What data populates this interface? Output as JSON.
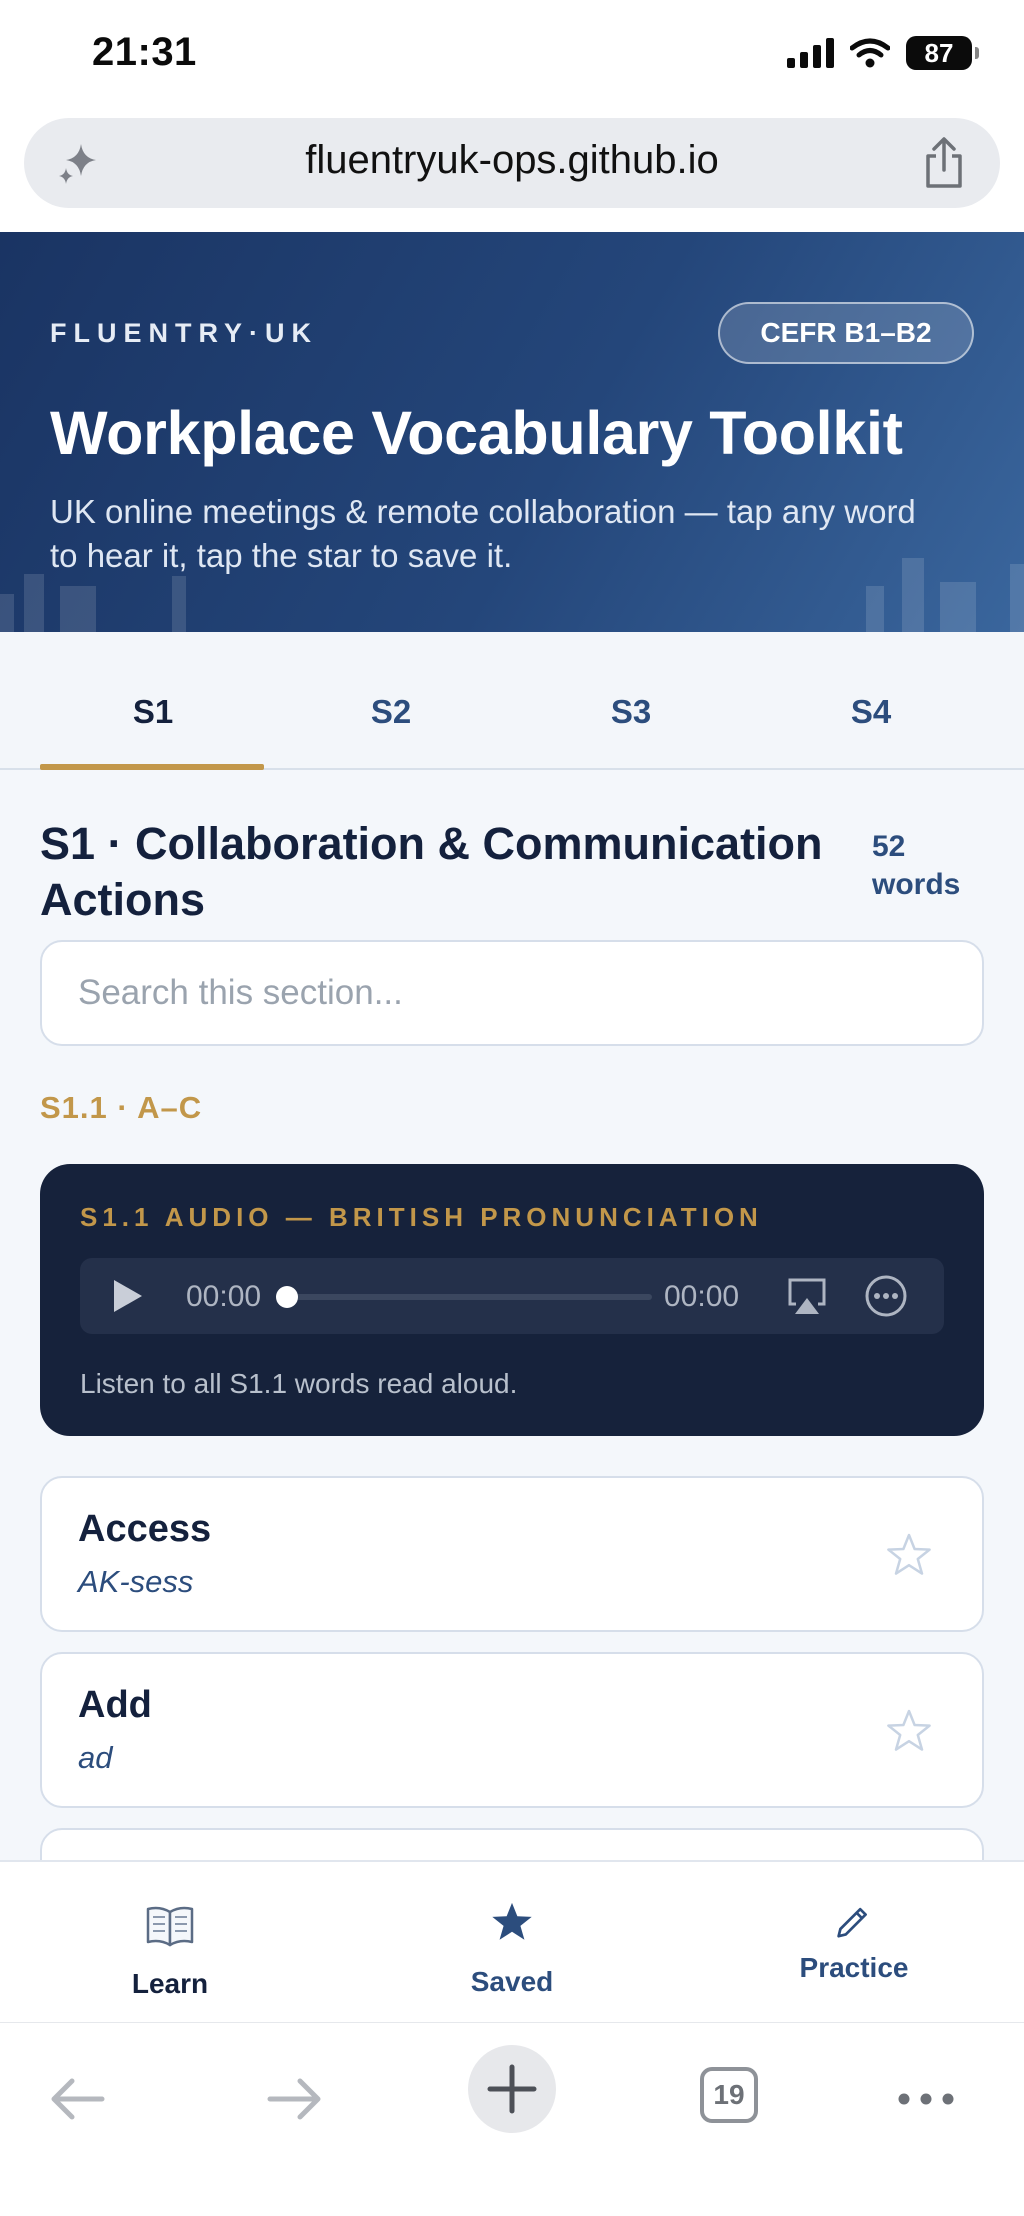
{
  "status_bar": {
    "time": "21:31",
    "battery": "87"
  },
  "browser": {
    "url": "fluentryuk-ops.github.io",
    "tab_count": "19"
  },
  "hero": {
    "brand": "FLUENTRY·UK",
    "level_badge": "CEFR B1–B2",
    "title": "Workplace Vocabulary Toolkit",
    "subtitle": "UK online meetings & remote collaboration — tap any word to hear it, tap the star to save it."
  },
  "tabs": [
    {
      "label": "S1",
      "active": true
    },
    {
      "label": "S2",
      "active": false
    },
    {
      "label": "S3",
      "active": false
    },
    {
      "label": "S4",
      "active": false
    }
  ],
  "section": {
    "title": "S1 · Collaboration & Communication Actions",
    "count_number": "52",
    "count_unit": "words",
    "search_placeholder": "Search this section...",
    "subsection": "S1.1 · A–C"
  },
  "audio": {
    "title": "S1.1 AUDIO — BRITISH PRONUNCIATION",
    "current_time": "00:00",
    "duration": "00:00",
    "progress": 0,
    "caption": "Listen to all S1.1 words read aloud."
  },
  "words": [
    {
      "term": "Access",
      "pronunciation": "AK-sess",
      "saved": false
    },
    {
      "term": "Add",
      "pronunciation": "ad",
      "saved": false
    }
  ],
  "bottom_nav": [
    {
      "label": "Learn",
      "icon": "book-icon",
      "active": true
    },
    {
      "label": "Saved",
      "icon": "star-icon",
      "active": false
    },
    {
      "label": "Practice",
      "icon": "pencil-icon",
      "active": false
    }
  ],
  "colors": {
    "hero_dark": "#1a3463",
    "accent_gold": "#c2974a",
    "navy_text": "#14213d",
    "link_blue": "#2c4d7d",
    "audio_card": "#16223b"
  }
}
